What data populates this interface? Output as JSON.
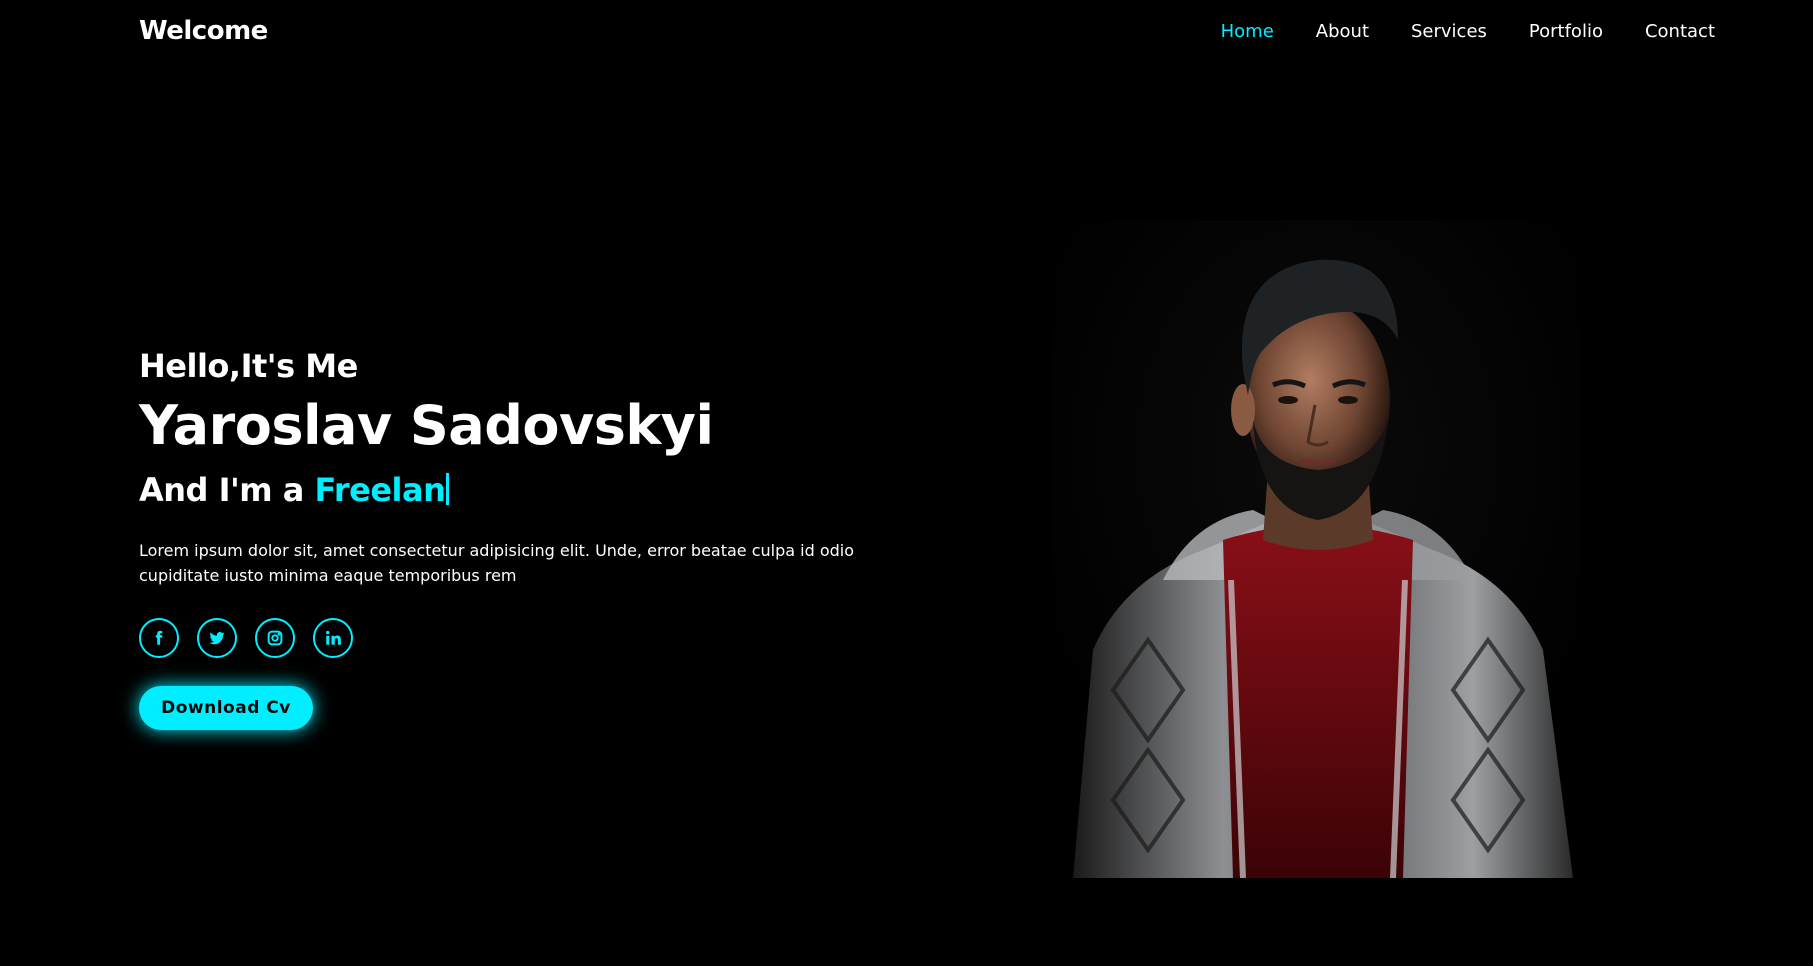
{
  "header": {
    "logo": "Welcome",
    "nav": [
      {
        "label": "Home",
        "active": true
      },
      {
        "label": "About",
        "active": false
      },
      {
        "label": "Services",
        "active": false
      },
      {
        "label": "Portfolio",
        "active": false
      },
      {
        "label": "Contact",
        "active": false
      }
    ]
  },
  "hero": {
    "greeting": "Hello,It's Me",
    "name": "Yaroslav Sadovskyi",
    "role_prefix": "And I'm a ",
    "role_typed": "Freelan",
    "description": "Lorem ipsum dolor sit, amet consectetur adipisicing elit. Unde, error beatae culpa id odio cupiditate iusto minima eaque temporibus rem",
    "social": [
      {
        "icon": "facebook-icon"
      },
      {
        "icon": "twitter-icon"
      },
      {
        "icon": "instagram-icon"
      },
      {
        "icon": "linkedin-icon"
      }
    ],
    "cta_label": "Download Cv"
  },
  "portrait": {
    "subject": "portrait-photo"
  },
  "colors": {
    "background": "#000000",
    "accent": "#00eeff",
    "text": "#ffffff"
  }
}
